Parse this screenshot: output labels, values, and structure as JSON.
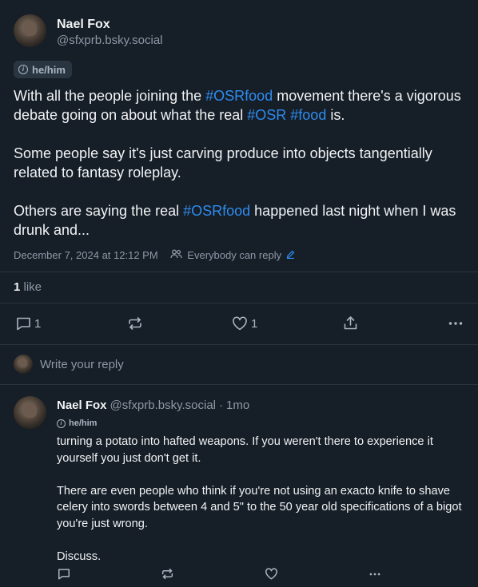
{
  "post": {
    "author_name": "Nael Fox",
    "author_handle": "@sfxprb.bsky.social",
    "pronouns": "he/him",
    "text": {
      "p1_a": "With all the people joining the ",
      "p1_tag1": "#OSRfood",
      "p1_b": " movement there's a vigorous debate going on about what the real ",
      "p1_tag2": "#OSR",
      "p1_c": " ",
      "p1_tag3": "#food",
      "p1_d": " is.",
      "p2": "Some people say it's just carving produce into objects tangentially related to fantasy roleplay.",
      "p3_a": "Others are saying the real ",
      "p3_tag": "#OSRfood",
      "p3_b": " happened last night when I was drunk and..."
    },
    "timestamp": "December 7, 2024 at 12:12 PM",
    "reply_setting": "Everybody can reply",
    "like_count": "1",
    "like_label": "like",
    "actions": {
      "reply_count": "1",
      "like_count": "1"
    }
  },
  "reply_input": {
    "placeholder": "Write your reply"
  },
  "reply": {
    "author_name": "Nael Fox",
    "author_handle": "@sfxprb.bsky.social",
    "time_sep": "·",
    "age": "1mo",
    "pronouns": "he/him",
    "p1": "turning a potato into hafted weapons. If you weren't there to experience it yourself you just don't get it.",
    "p2": "There are even people who think if you're not using an exacto knife to shave celery into swords between 4 and 5\" to the 50 year old specifications of a bigot you're just wrong.",
    "p3": "Discuss."
  },
  "colors": {
    "background": "#161e27",
    "accent": "#2f8cf0",
    "muted": "#8d99a6",
    "divider": "#2b3541"
  }
}
